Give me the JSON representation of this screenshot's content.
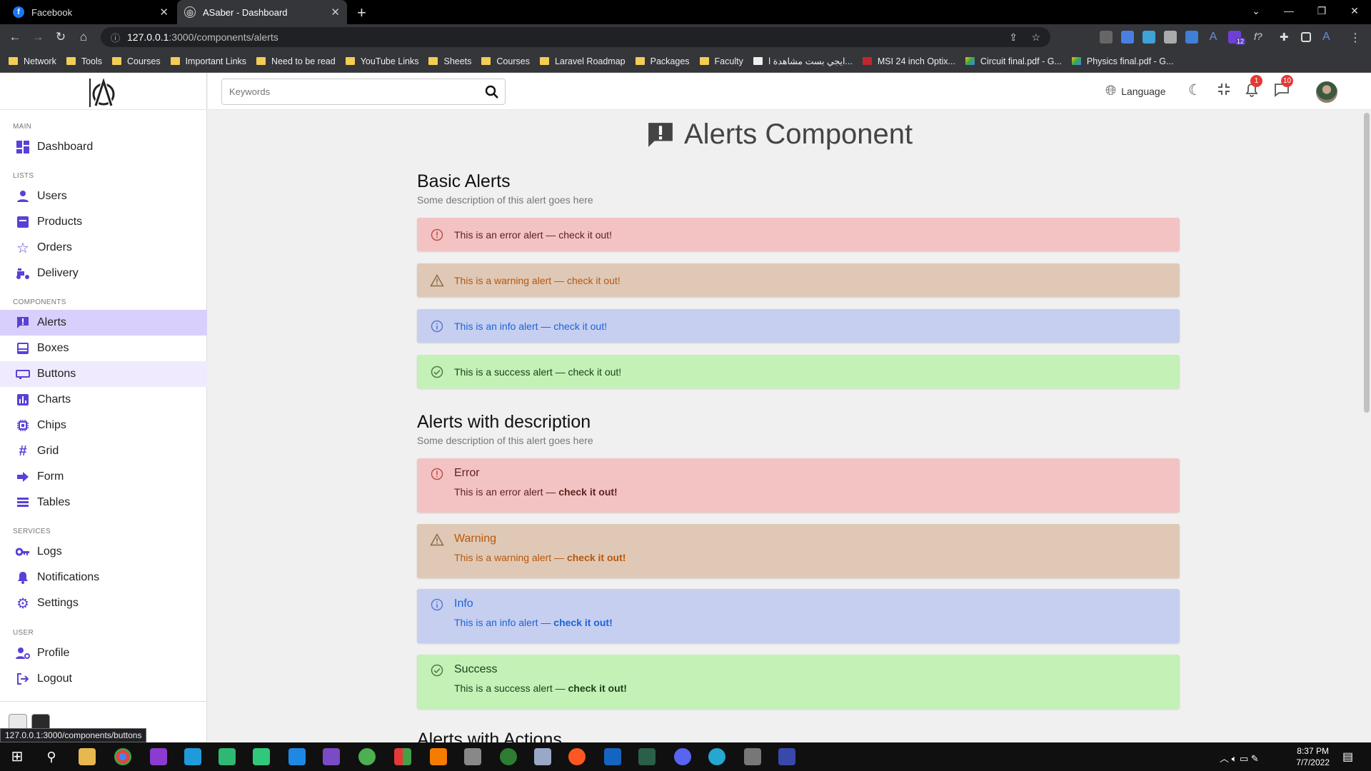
{
  "browser": {
    "tabs": [
      {
        "label": "Facebook",
        "icon": "facebook-icon"
      },
      {
        "label": "ASaber - Dashboard",
        "icon": "globe-icon"
      }
    ],
    "url_host": "127.0.0.1",
    "url_path": ":3000/components/alerts",
    "bookmarks": [
      "Network",
      "Tools",
      "Courses",
      "Important Links",
      "Need to be read",
      "YouTube Links",
      "Sheets",
      "Courses",
      "Laravel Roadmap",
      "Packages",
      "Faculty",
      "ايجي بست مشاهدة ا...",
      "MSI 24 inch Optix...",
      "Circuit final.pdf - G...",
      "Physics final.pdf - G..."
    ],
    "extension_badge": "12",
    "status_url": "127.0.0.1:3000/components/buttons"
  },
  "sidebar": {
    "sections": [
      {
        "label": "MAIN",
        "items": [
          {
            "label": "Dashboard",
            "icon": "dashboard-icon"
          }
        ]
      },
      {
        "label": "LISTS",
        "items": [
          {
            "label": "Users",
            "icon": "user-icon"
          },
          {
            "label": "Products",
            "icon": "product-icon"
          },
          {
            "label": "Orders",
            "icon": "star-icon"
          },
          {
            "label": "Delivery",
            "icon": "delivery-icon"
          }
        ]
      },
      {
        "label": "COMPONENTS",
        "items": [
          {
            "label": "Alerts",
            "icon": "alert-icon"
          },
          {
            "label": "Boxes",
            "icon": "inbox-icon"
          },
          {
            "label": "Buttons",
            "icon": "button-icon"
          },
          {
            "label": "Charts",
            "icon": "chart-icon"
          },
          {
            "label": "Chips",
            "icon": "chip-icon"
          },
          {
            "label": "Grid",
            "icon": "grid-icon"
          },
          {
            "label": "Form",
            "icon": "arrow-icon"
          },
          {
            "label": "Tables",
            "icon": "table-icon"
          }
        ]
      },
      {
        "label": "SERVICES",
        "items": [
          {
            "label": "Logs",
            "icon": "key-icon"
          },
          {
            "label": "Notifications",
            "icon": "bell-icon"
          },
          {
            "label": "Settings",
            "icon": "gear-icon"
          }
        ]
      },
      {
        "label": "USER",
        "items": [
          {
            "label": "Profile",
            "icon": "profile-icon"
          },
          {
            "label": "Logout",
            "icon": "logout-icon"
          }
        ]
      }
    ],
    "active": "Alerts",
    "hovered": "Buttons"
  },
  "topbar": {
    "search_placeholder": "Keywords",
    "language_label": "Language",
    "notifications_count": "1",
    "messages_count": "10"
  },
  "page": {
    "title": "Alerts Component",
    "basic": {
      "heading": "Basic Alerts",
      "description": "Some description of this alert goes here",
      "alerts": [
        {
          "type": "error",
          "text": "This is an error alert — check it out!"
        },
        {
          "type": "warning",
          "text": "This is a warning alert — check it out!"
        },
        {
          "type": "info",
          "text": "This is an info alert — check it out!"
        },
        {
          "type": "success",
          "text": "This is a success alert — check it out!"
        }
      ]
    },
    "described": {
      "heading": "Alerts with description",
      "description": "Some description of this alert goes here",
      "alerts": [
        {
          "type": "error",
          "title": "Error",
          "text": "This is an error alert — ",
          "strong": "check it out!"
        },
        {
          "type": "warning",
          "title": "Warning",
          "text": "This is a warning alert — ",
          "strong": "check it out!"
        },
        {
          "type": "info",
          "title": "Info",
          "text": "This is an info alert — ",
          "strong": "check it out!"
        },
        {
          "type": "success",
          "title": "Success",
          "text": "This is a success alert — ",
          "strong": "check it out!"
        }
      ]
    },
    "next_heading": "Alerts with Actions"
  },
  "taskbar": {
    "time": "8:37 PM",
    "date": "7/7/2022"
  },
  "colors": {
    "accent": "#5b40d6",
    "error_bg": "#f3c3c3",
    "warning_bg": "#dfc9b6",
    "info_bg": "#c6cff0",
    "success_bg": "#c3f1b6"
  }
}
